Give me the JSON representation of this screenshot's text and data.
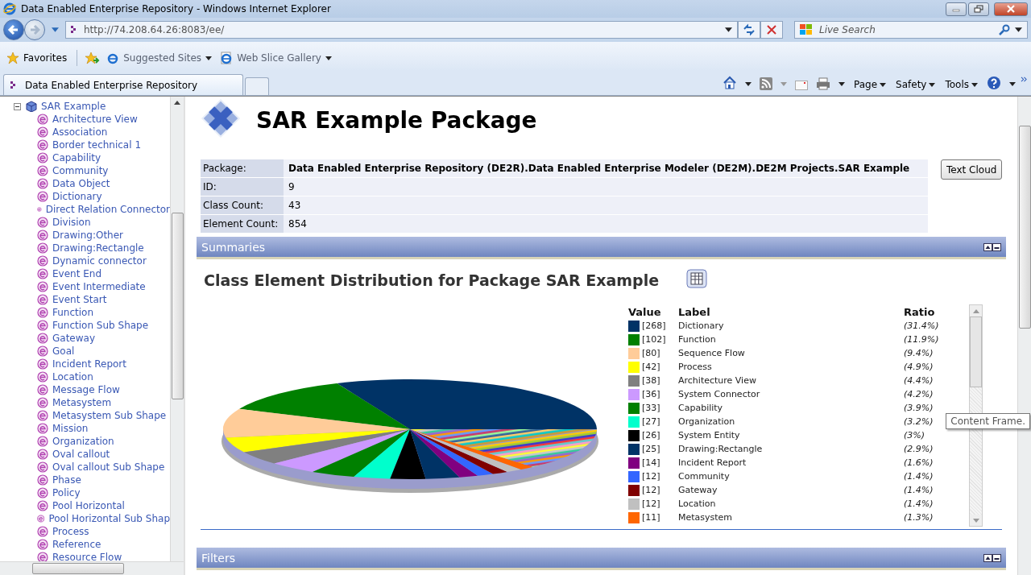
{
  "window": {
    "title": "Data Enabled Enterprise Repository - Windows Internet Explorer"
  },
  "browser": {
    "address": "http://74.208.64.26:8083/ee/",
    "search": {
      "placeholder": "Live Search"
    },
    "favorites": "Favorites",
    "links": [
      "Suggested Sites",
      "Web Slice Gallery"
    ],
    "tab": {
      "title": "Data Enabled Enterprise Repository"
    },
    "commands": [
      "Page",
      "Safety",
      "Tools"
    ]
  },
  "tree": {
    "root": {
      "label": "SAR Example",
      "expanded": true,
      "children": [
        {
          "label": "Architecture View"
        },
        {
          "label": "Association"
        },
        {
          "label": "Border technical 1"
        },
        {
          "label": "Capability"
        },
        {
          "label": "Community"
        },
        {
          "label": "Data Object"
        },
        {
          "label": "Dictionary"
        },
        {
          "label": "Direct Relation Connector"
        },
        {
          "label": "Division"
        },
        {
          "label": "Drawing:Other"
        },
        {
          "label": "Drawing:Rectangle"
        },
        {
          "label": "Dynamic connector"
        },
        {
          "label": "Event End"
        },
        {
          "label": "Event Intermediate"
        },
        {
          "label": "Event Start"
        },
        {
          "label": "Function"
        },
        {
          "label": "Function Sub Shape"
        },
        {
          "label": "Gateway"
        },
        {
          "label": "Goal"
        },
        {
          "label": "Incident Report"
        },
        {
          "label": "Location"
        },
        {
          "label": "Message Flow"
        },
        {
          "label": "Metasystem"
        },
        {
          "label": "Metasystem Sub Shape"
        },
        {
          "label": "Mission"
        },
        {
          "label": "Organization"
        },
        {
          "label": "Oval callout"
        },
        {
          "label": "Oval callout Sub Shape"
        },
        {
          "label": "Phase"
        },
        {
          "label": "Policy"
        },
        {
          "label": "Pool Horizontal"
        },
        {
          "label": "Pool Horizontal Sub Shap"
        },
        {
          "label": "Process"
        },
        {
          "label": "Reference"
        },
        {
          "label": "Resource Flow"
        }
      ]
    }
  },
  "page": {
    "title": "SAR Example Package",
    "info": [
      {
        "label": "Package:",
        "value": "Data Enabled Enterprise Repository (DE2R).Data Enabled Enterprise Modeler (DE2M).DE2M Projects.SAR Example",
        "bold": true
      },
      {
        "label": "ID:",
        "value": "9",
        "bold": false
      },
      {
        "label": "Class Count:",
        "value": "43",
        "bold": false
      },
      {
        "label": "Element Count:",
        "value": "854",
        "bold": false
      }
    ],
    "text_cloud_button": "Text Cloud",
    "summaries": {
      "title": "Summaries",
      "expanded": true
    },
    "chart_title": "Class Element Distribution for Package SAR Example",
    "legend": {
      "headers": [
        "Value",
        "Label",
        "Ratio"
      ],
      "items": [
        {
          "value": "[268]",
          "label": "Dictionary",
          "ratio": "(31.4%)",
          "color": "#003366"
        },
        {
          "value": "[102]",
          "label": "Function",
          "ratio": "(11.9%)",
          "color": "#008000"
        },
        {
          "value": "[80]",
          "label": "Sequence Flow",
          "ratio": "(9.4%)",
          "color": "#ffcc99"
        },
        {
          "value": "[42]",
          "label": "Process",
          "ratio": "(4.9%)",
          "color": "#ffff00"
        },
        {
          "value": "[38]",
          "label": "Architecture View",
          "ratio": "(4.4%)",
          "color": "#808080"
        },
        {
          "value": "[36]",
          "label": "System Connector",
          "ratio": "(4.2%)",
          "color": "#cc99ff"
        },
        {
          "value": "[33]",
          "label": "Capability",
          "ratio": "(3.9%)",
          "color": "#008000"
        },
        {
          "value": "[27]",
          "label": "Organization",
          "ratio": "(3.2%)",
          "color": "#00ffcc"
        },
        {
          "value": "[26]",
          "label": "System Entity",
          "ratio": "(3%)",
          "color": "#000000"
        },
        {
          "value": "[25]",
          "label": "Drawing:Rectangle",
          "ratio": "(2.9%)",
          "color": "#003366"
        },
        {
          "value": "[14]",
          "label": "Incident Report",
          "ratio": "(1.6%)",
          "color": "#800080"
        },
        {
          "value": "[12]",
          "label": "Community",
          "ratio": "(1.4%)",
          "color": "#3366ff"
        },
        {
          "value": "[12]",
          "label": "Gateway",
          "ratio": "(1.4%)",
          "color": "#800000"
        },
        {
          "value": "[12]",
          "label": "Location",
          "ratio": "(1.4%)",
          "color": "#c0c0c0"
        },
        {
          "value": "[11]",
          "label": "Metasystem",
          "ratio": "(1.3%)",
          "color": "#ff6600"
        }
      ]
    },
    "filters": {
      "title": "Filters",
      "expanded": true
    }
  },
  "tooltip": "Content Frame."
}
